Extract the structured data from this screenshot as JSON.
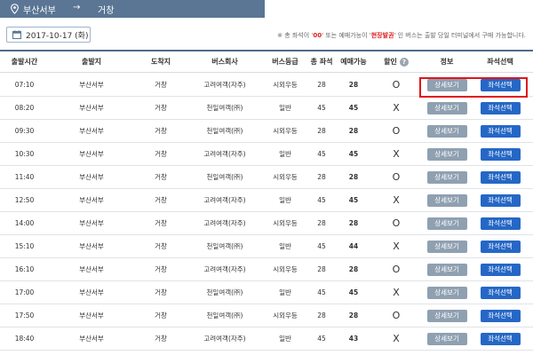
{
  "route": {
    "from": "부산서부",
    "arrow": "→",
    "to": "거창"
  },
  "date_button": {
    "label": "2017-10-17 (화)"
  },
  "notice": {
    "prefix": "※ 총 좌석이 '",
    "zero": "00",
    "middle": "' 또는 예매가능이 '",
    "onsite": "현장발권",
    "suffix": "' 인 버스는 출발 당일 터미널에서 구매 가능합니다."
  },
  "headers": [
    "출발시간",
    "출발지",
    "도착지",
    "버스회사",
    "버스등급",
    "총 좌석",
    "예매가능",
    "할인",
    "정보",
    "좌석선택"
  ],
  "buttons": {
    "detail": "상세보기",
    "seat": "좌석선택"
  },
  "icons": {
    "help": "?"
  },
  "rows": [
    {
      "time": "07:10",
      "from": "부산서부",
      "to": "거창",
      "company": "고려여객(자주)",
      "grade": "시외우등",
      "total": "28",
      "avail": "28",
      "discount": "O"
    },
    {
      "time": "08:20",
      "from": "부산서부",
      "to": "거창",
      "company": "천일여객(㈜)",
      "grade": "일반",
      "total": "45",
      "avail": "45",
      "discount": "X"
    },
    {
      "time": "09:30",
      "from": "부산서부",
      "to": "거창",
      "company": "천일여객(㈜)",
      "grade": "시외우등",
      "total": "28",
      "avail": "28",
      "discount": "O"
    },
    {
      "time": "10:30",
      "from": "부산서부",
      "to": "거창",
      "company": "고려여객(자주)",
      "grade": "일반",
      "total": "45",
      "avail": "45",
      "discount": "X"
    },
    {
      "time": "11:40",
      "from": "부산서부",
      "to": "거창",
      "company": "천일여객(㈜)",
      "grade": "시외우등",
      "total": "28",
      "avail": "28",
      "discount": "O"
    },
    {
      "time": "12:50",
      "from": "부산서부",
      "to": "거창",
      "company": "고려여객(자주)",
      "grade": "일반",
      "total": "45",
      "avail": "45",
      "discount": "X"
    },
    {
      "time": "14:00",
      "from": "부산서부",
      "to": "거창",
      "company": "고려여객(자주)",
      "grade": "시외우등",
      "total": "28",
      "avail": "28",
      "discount": "O"
    },
    {
      "time": "15:10",
      "from": "부산서부",
      "to": "거창",
      "company": "천일여객(㈜)",
      "grade": "일반",
      "total": "45",
      "avail": "44",
      "discount": "X"
    },
    {
      "time": "16:10",
      "from": "부산서부",
      "to": "거창",
      "company": "고려여객(자주)",
      "grade": "시외우등",
      "total": "28",
      "avail": "28",
      "discount": "O"
    },
    {
      "time": "17:00",
      "from": "부산서부",
      "to": "거창",
      "company": "천일여객(㈜)",
      "grade": "일반",
      "total": "45",
      "avail": "45",
      "discount": "X"
    },
    {
      "time": "17:50",
      "from": "부산서부",
      "to": "거창",
      "company": "천일여객(㈜)",
      "grade": "시외우등",
      "total": "28",
      "avail": "28",
      "discount": "O"
    },
    {
      "time": "18:40",
      "from": "부산서부",
      "to": "거창",
      "company": "고려여객(자주)",
      "grade": "일반",
      "total": "45",
      "avail": "43",
      "discount": "X"
    }
  ]
}
